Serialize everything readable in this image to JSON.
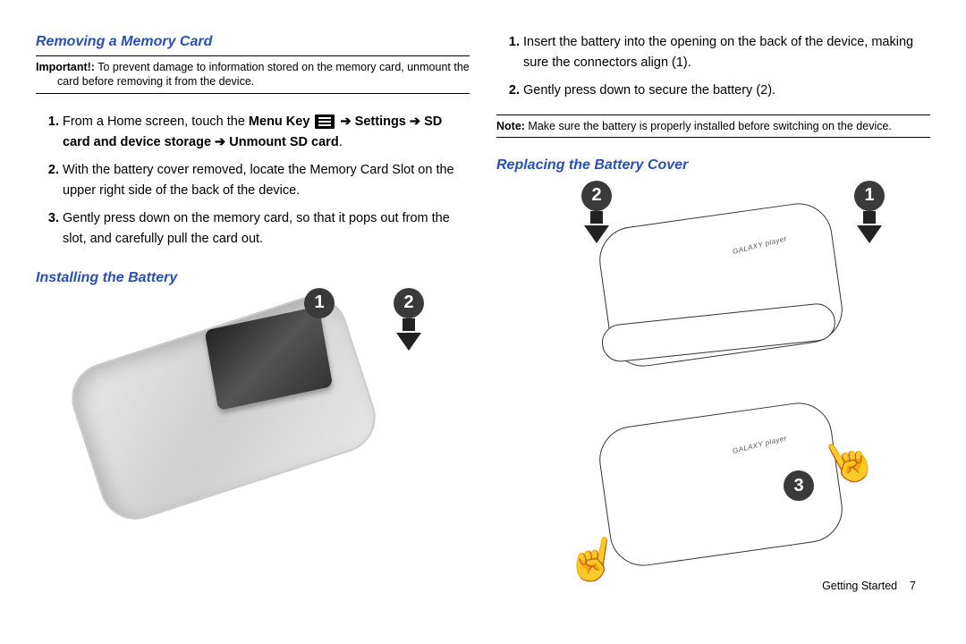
{
  "left": {
    "heading1": "Removing a Memory Card",
    "important_label": "Important!:",
    "important_text": " To prevent damage to information stored on the memory card, unmount the card before removing it from the device.",
    "steps1": {
      "s1_pre": "From a Home screen, touch the ",
      "s1_menu": "Menu Key",
      "s1_arrow1": " ➔ ",
      "s1_settings": "Settings",
      "s1_arrow2": " ➔ ",
      "s1_sd": "SD card and device storage",
      "s1_arrow3": " ➔ ",
      "s1_unmount": "Unmount SD card",
      "s1_end": ".",
      "s2": "With the battery cover removed, locate the Memory Card Slot on the upper right side of the back of the device.",
      "s3": "Gently press down on the memory card, so that it pops out from the slot, and carefully pull the card out."
    },
    "heading2": "Installing the Battery",
    "callouts": {
      "c1": "1",
      "c2": "2"
    }
  },
  "right": {
    "steps2": {
      "s1": "Insert the battery into the opening on the back of the device, making sure the connectors align (1).",
      "s2": "Gently press down to secure the battery (2)."
    },
    "note_label": "Note:",
    "note_text": " Make sure the battery is properly installed before switching on the device.",
    "heading3": "Replacing the Battery Cover",
    "callouts": {
      "c1": "1",
      "c2": "2",
      "c3": "3"
    },
    "galaxy": "GALAXY player"
  },
  "footer": {
    "section": "Getting Started",
    "page": "7"
  }
}
